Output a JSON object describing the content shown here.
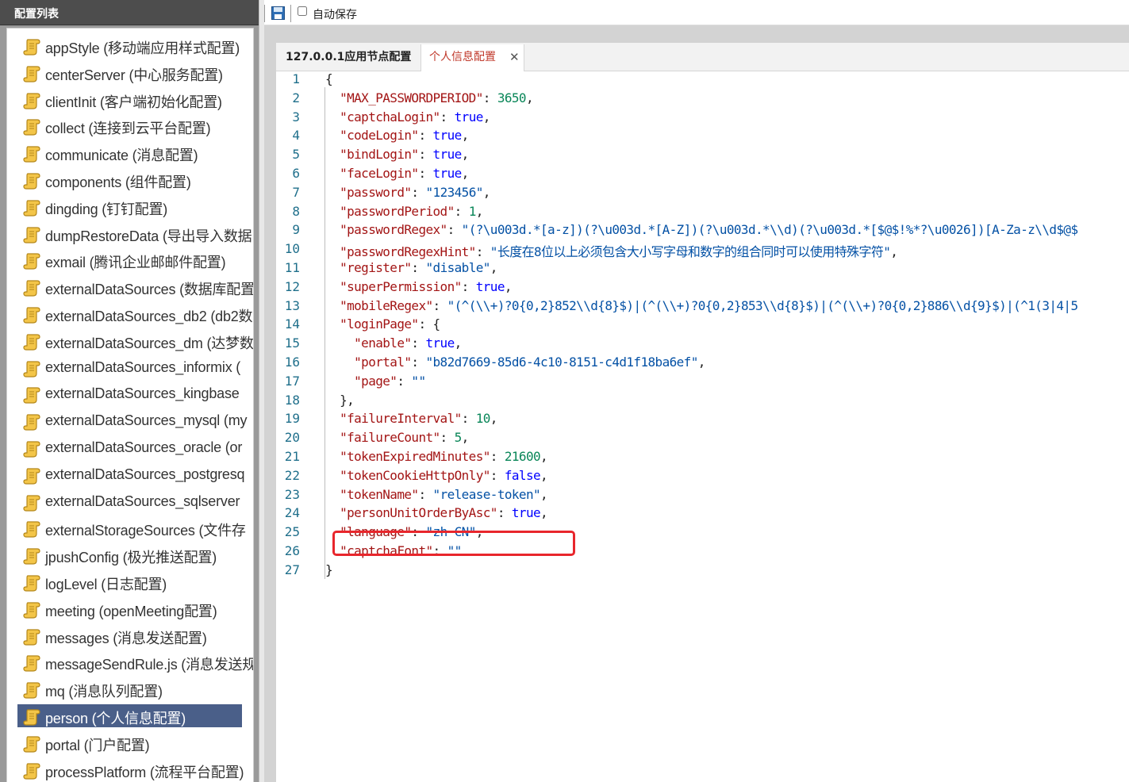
{
  "sidebar": {
    "title": "配置列表",
    "items": [
      {
        "label": "appStyle (移动端应用样式配置)",
        "selected": false
      },
      {
        "label": "centerServer (中心服务配置)",
        "selected": false
      },
      {
        "label": "clientInit (客户端初始化配置)",
        "selected": false
      },
      {
        "label": "collect (连接到云平台配置)",
        "selected": false
      },
      {
        "label": "communicate (消息配置)",
        "selected": false
      },
      {
        "label": "components (组件配置)",
        "selected": false
      },
      {
        "label": "dingding (钉钉配置)",
        "selected": false
      },
      {
        "label": "dumpRestoreData (导出导入数据",
        "selected": false
      },
      {
        "label": "exmail (腾讯企业邮邮件配置)",
        "selected": false
      },
      {
        "label": "externalDataSources (数据库配置",
        "selected": false
      },
      {
        "label": "externalDataSources_db2 (db2数",
        "selected": false
      },
      {
        "label": "externalDataSources_dm (达梦数",
        "selected": false
      },
      {
        "label": "externalDataSources_informix (",
        "selected": false
      },
      {
        "label": "externalDataSources_kingbase",
        "selected": false
      },
      {
        "label": "externalDataSources_mysql (my",
        "selected": false
      },
      {
        "label": "externalDataSources_oracle (or",
        "selected": false
      },
      {
        "label": "externalDataSources_postgresq",
        "selected": false
      },
      {
        "label": "externalDataSources_sqlserver",
        "selected": false
      },
      {
        "label": "externalStorageSources (文件存",
        "selected": false
      },
      {
        "label": "jpushConfig (极光推送配置)",
        "selected": false
      },
      {
        "label": "logLevel (日志配置)",
        "selected": false
      },
      {
        "label": "meeting (openMeeting配置)",
        "selected": false
      },
      {
        "label": "messages (消息发送配置)",
        "selected": false
      },
      {
        "label": "messageSendRule.js (消息发送规",
        "selected": false
      },
      {
        "label": "mq (消息队列配置)",
        "selected": false
      },
      {
        "label": "person (个人信息配置)",
        "selected": true
      },
      {
        "label": "portal (门户配置)",
        "selected": false
      },
      {
        "label": "processPlatform (流程平台配置)",
        "selected": false
      }
    ],
    "icon": "scroll-icon"
  },
  "toolbar": {
    "save_icon": "save-icon",
    "autosave_label": "自动保存",
    "autosave_checked": false
  },
  "tabs": [
    {
      "label": "127.0.0.1应用节点配置",
      "active": false
    },
    {
      "label": "个人信息配置",
      "active": true,
      "close": "✕"
    }
  ],
  "editor": {
    "lines": [
      {
        "n": "1",
        "html": "{"
      },
      {
        "n": "2",
        "html": "  <span class=\"k\">\"MAX_PASSWORDPERIOD\"</span>: <span class=\"n\">3650</span>,"
      },
      {
        "n": "3",
        "html": "  <span class=\"k\">\"captchaLogin\"</span>: <span class=\"b\">true</span>,"
      },
      {
        "n": "4",
        "html": "  <span class=\"k\">\"codeLogin\"</span>: <span class=\"b\">true</span>,"
      },
      {
        "n": "5",
        "html": "  <span class=\"k\">\"bindLogin\"</span>: <span class=\"b\">true</span>,"
      },
      {
        "n": "6",
        "html": "  <span class=\"k\">\"faceLogin\"</span>: <span class=\"b\">true</span>,"
      },
      {
        "n": "7",
        "html": "  <span class=\"k\">\"password\"</span>: <span class=\"s\">\"123456\"</span>,"
      },
      {
        "n": "8",
        "html": "  <span class=\"k\">\"passwordPeriod\"</span>: <span class=\"n\">1</span>,"
      },
      {
        "n": "9",
        "html": "  <span class=\"k\">\"passwordRegex\"</span>: <span class=\"s\">\"(?\\u003d.*[a-z])(?\\u003d.*[A-Z])(?\\u003d.*\\\\d)(?\\u003d.*[$@$!%*?\\u0026])[A-Za-z\\\\d$@$</span>"
      },
      {
        "n": "10",
        "html": "  <span class=\"k\">\"passwordRegexHint\"</span>: <span class=\"s\">\"长度在8位以上必须包含大小写字母和数字的组合同时可以使用特殊字符\"</span>,"
      },
      {
        "n": "11",
        "html": "  <span class=\"k\">\"register\"</span>: <span class=\"s\">\"disable\"</span>,"
      },
      {
        "n": "12",
        "html": "  <span class=\"k\">\"superPermission\"</span>: <span class=\"b\">true</span>,"
      },
      {
        "n": "13",
        "html": "  <span class=\"k\">\"mobileRegex\"</span>: <span class=\"s\">\"(^(\\\\+)?0{0,2}852\\\\d{8}$)|(^(\\\\+)?0{0,2}853\\\\d{8}$)|(^(\\\\+)?0{0,2}886\\\\d{9}$)|(^1(3|4|5</span>"
      },
      {
        "n": "14",
        "html": "  <span class=\"k\">\"loginPage\"</span>: {"
      },
      {
        "n": "15",
        "html": "    <span class=\"k\">\"enable\"</span>: <span class=\"b\">true</span>,"
      },
      {
        "n": "16",
        "html": "    <span class=\"k\">\"portal\"</span>: <span class=\"s\">\"b82d7669-85d6-4c10-8151-c4d1f18ba6ef\"</span>,"
      },
      {
        "n": "17",
        "html": "    <span class=\"k\">\"page\"</span>: <span class=\"s\">\"\"</span>"
      },
      {
        "n": "18",
        "html": "  },"
      },
      {
        "n": "19",
        "html": "  <span class=\"k\">\"failureInterval\"</span>: <span class=\"n\">10</span>,"
      },
      {
        "n": "20",
        "html": "  <span class=\"k\">\"failureCount\"</span>: <span class=\"n\">5</span>,"
      },
      {
        "n": "21",
        "html": "  <span class=\"k\">\"tokenExpiredMinutes\"</span>: <span class=\"n\">21600</span>,"
      },
      {
        "n": "22",
        "html": "  <span class=\"k\">\"tokenCookieHttpOnly\"</span>: <span class=\"b\">false</span>,"
      },
      {
        "n": "23",
        "html": "  <span class=\"k\">\"tokenName\"</span>: <span class=\"s\">\"release-token\"</span>,"
      },
      {
        "n": "24",
        "html": "  <span class=\"k\">\"personUnitOrderByAsc\"</span>: <span class=\"b\">true</span>,"
      },
      {
        "n": "25",
        "html": "  <span class=\"k\">\"language\"</span>: <span class=\"s\">\"zh-CN\"</span>,"
      },
      {
        "n": "26",
        "html": "  <span class=\"k\">\"captchaFont\"</span>: <span class=\"s\">\"\"</span>"
      },
      {
        "n": "27",
        "html": "}"
      }
    ],
    "highlight_line": "23",
    "highlight_color": "#e8262c"
  }
}
